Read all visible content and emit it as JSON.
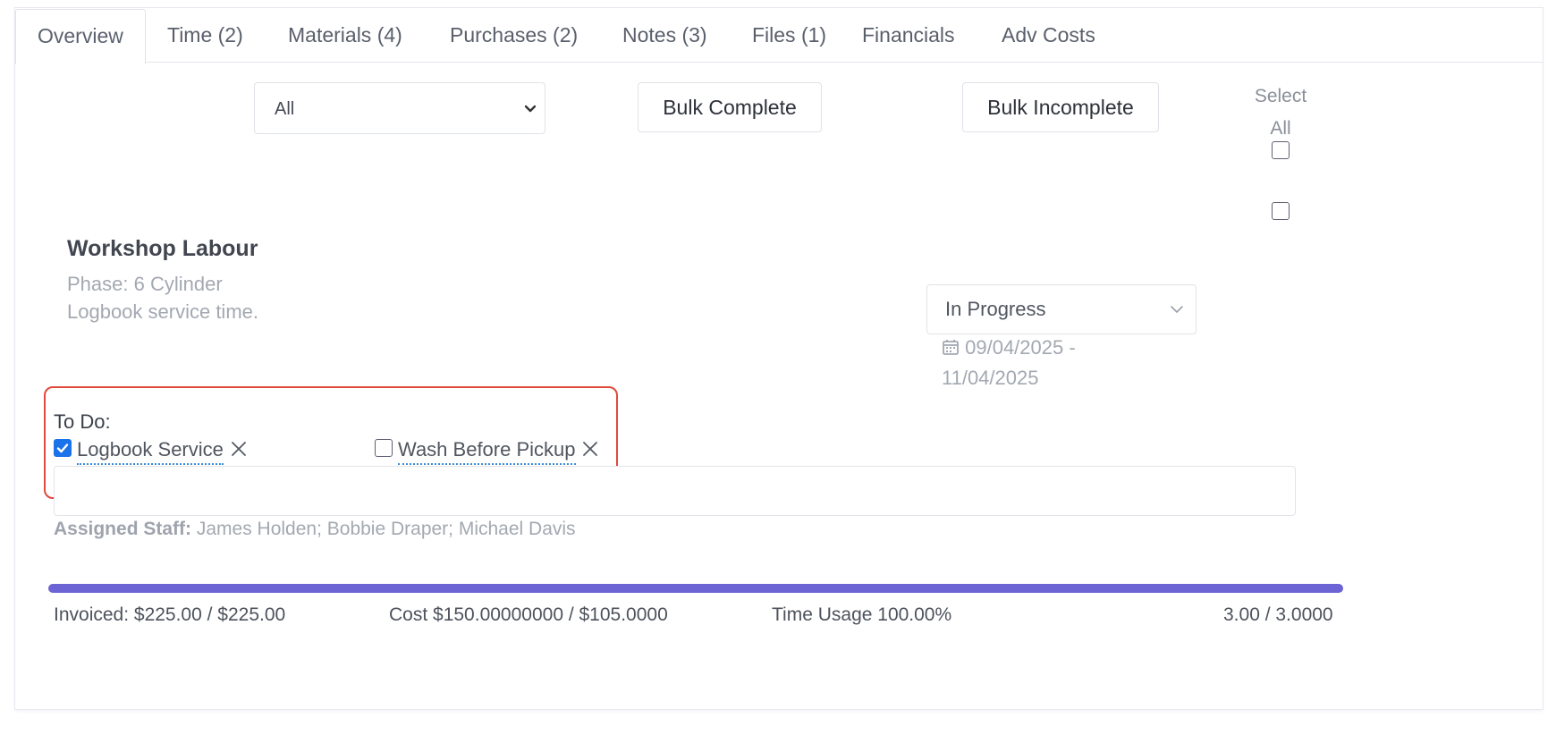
{
  "tabs": [
    {
      "label": "Overview",
      "active": true
    },
    {
      "label": "Time (2)"
    },
    {
      "label": "Materials (4)"
    },
    {
      "label": "Purchases (2)"
    },
    {
      "label": "Notes (3)"
    },
    {
      "label": "Files (1)"
    },
    {
      "label": "Financials"
    },
    {
      "label": "Adv Costs"
    }
  ],
  "toolbar": {
    "filter_value": "All",
    "bulk_complete_label": "Bulk Complete",
    "bulk_incomplete_label": "Bulk Incomplete",
    "select_all_line1": "Select",
    "select_all_line2": "All"
  },
  "task": {
    "title": "Workshop Labour",
    "phase": "Phase: 6 Cylinder",
    "description": "Logbook service time.",
    "status": "In Progress",
    "date_line1": "09/04/2025 -",
    "date_line2": "11/04/2025",
    "selected": false
  },
  "todo": {
    "label": "To Do:",
    "items": [
      {
        "label": "Logbook Service",
        "checked": true
      },
      {
        "label": "Wash Before Pickup",
        "checked": false
      }
    ],
    "input_value": ""
  },
  "staff": {
    "label": "Assigned Staff:",
    "names": "James Holden; Bobbie Draper; Michael Davis"
  },
  "progress": {
    "percent": 100
  },
  "footer": {
    "invoiced": "Invoiced: $225.00 / $225.00",
    "cost": "Cost $150.00000000 / $105.0000",
    "time_usage": "Time Usage 100.00%",
    "hours": "3.00 / 3.0000"
  },
  "colors": {
    "progress_fill": "#6c63d4",
    "highlight_border": "#e04a3c",
    "checkbox_checked": "#1a73e8",
    "todo_underline": "#3b8bd6"
  },
  "icons": [
    "chevron-down-icon",
    "calendar-icon",
    "close-icon",
    "check-icon"
  ]
}
